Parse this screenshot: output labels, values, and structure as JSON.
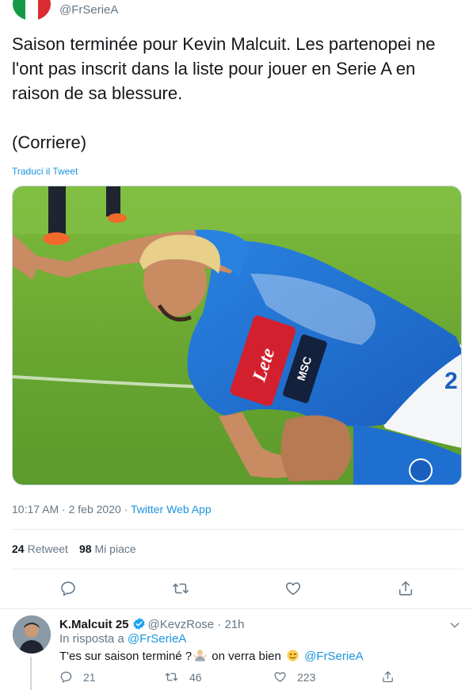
{
  "header": {
    "handle": "@FrSerieA"
  },
  "tweet": {
    "paragraphs": [
      "Saison terminée pour Kevin Malcuit. Les partenopei ne l'ont pas inscrit dans la liste pour jouer en Serie A en raison de sa blessure.",
      "(Corriere)"
    ],
    "translate_label": "Traduci il Tweet",
    "media": {
      "shirt_sponsor": "Lete",
      "sleeve_sponsor": "MSC",
      "shorts_number": "2"
    },
    "timestamp": "10:17 AM · 2 feb 2020 · ",
    "source": "Twitter Web App"
  },
  "stats": {
    "retweets_count": "24",
    "retweets_label": "Retweet",
    "likes_count": "98",
    "likes_label": "Mi piace"
  },
  "actions": [
    "reply-icon",
    "retweet-icon",
    "like-icon",
    "share-icon"
  ],
  "reply": {
    "name": "K.Malcuit 25",
    "handle": "@KevzRose",
    "separator": " · ",
    "time": "21h",
    "in_reply_prefix": "In risposta a ",
    "in_reply_to": "@FrSerieA",
    "text_part1": "T'es sur saison terminé ?",
    "text_part2": " on verra bien ",
    "mention": "@FrSerieA",
    "replies": "21",
    "retweets": "46",
    "likes": "223"
  },
  "colors": {
    "accent": "#1b95e0",
    "secondary_text": "#657786",
    "napoli_blue": "#1f6fd1",
    "sponsor_red": "#d3202e"
  }
}
